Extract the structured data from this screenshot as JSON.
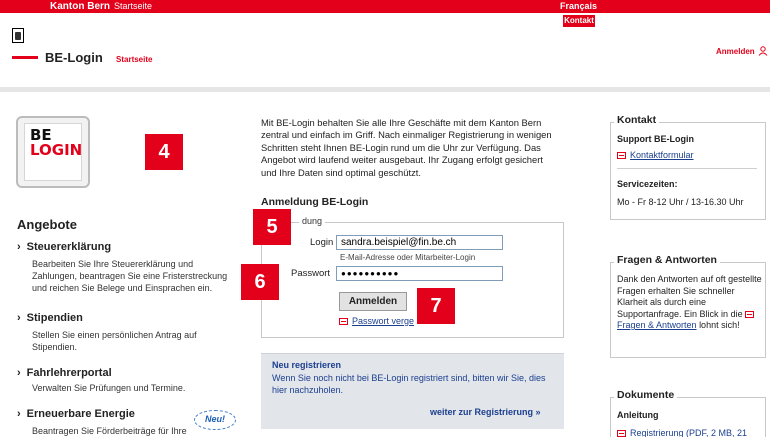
{
  "topbar": {
    "brand": "Kanton Bern",
    "startseite": "Startseite",
    "lang": "Français"
  },
  "header": {
    "kontakt": "Kontakt",
    "title": "BE-Login",
    "startseite": "Startseite",
    "anmelden": "Anmelden"
  },
  "logo": {
    "be": "BE",
    "login": "LOGIN"
  },
  "badges": {
    "b4": "4",
    "b5": "5",
    "b6": "6",
    "b7": "7"
  },
  "angebote": {
    "heading": "Angebote",
    "items": [
      {
        "title": "Steuererklärung",
        "desc": "Bearbeiten Sie Ihre Steuererklärung und Zahlungen, beantragen Sie eine Fristerstreckung und reichen Sie Belege und Einsprachen ein."
      },
      {
        "title": "Stipendien",
        "desc": "Stellen Sie einen persönlichen Antrag auf Stipendien."
      },
      {
        "title": "Fahrlehrerportal",
        "desc": "Verwalten Sie Prüfungen und Termine."
      },
      {
        "title": "Erneuerbare Energie",
        "desc": "Beantragen Sie Förderbeiträge für Ihre"
      }
    ],
    "neu": "Neu!"
  },
  "main": {
    "intro": "Mit BE-Login behalten Sie alle Ihre Geschäfte mit dem Kanton Bern zentral und einfach im Griff. Nach einmaliger Registrierung in wenigen Schritten steht Ihnen BE-Login rund um die Uhr zur Verfügung. Das Angebot wird laufend weiter ausgebaut. Ihr Zugang erfolgt gesichert und Ihre Daten sind optimal geschützt.",
    "heading": "Anmeldung BE-Login",
    "legend": "dung",
    "login_label": "Login",
    "login_value": "sandra.beispiel@fin.be.ch",
    "login_hint": "E-Mail-Adresse oder Mitarbeiter-Login",
    "pw_label": "Passwort",
    "pw_value": "●●●●●●●●●●",
    "button": "Anmelden",
    "pw_link": "Passwort verge"
  },
  "register": {
    "heading": "Neu registrieren",
    "text": "Wenn Sie noch nicht bei BE-Login registriert sind, bitten wir Sie, dies hier nachzuholen.",
    "link": "weiter zur Registrierung  »"
  },
  "right": {
    "kontakt": {
      "heading": "Kontakt",
      "support": "Support BE-Login",
      "formular": "Kontaktformular",
      "service_h": "Servicezeiten:",
      "service": "Mo - Fr 8-12 Uhr / 13-16.30 Uhr"
    },
    "faq": {
      "heading": "Fragen & Antworten",
      "text": "Dank den Antworten auf oft gestellte Fragen erhalten Sie schneller Klarheit als durch eine Supportanfrage. Ein Blick in die",
      "link": "Fragen & Antworten",
      "after": "lohnt sich!"
    },
    "docs": {
      "heading": "Dokumente",
      "anleitung": "Anleitung",
      "item": "Registrierung (PDF, 2 MB, 21"
    }
  }
}
